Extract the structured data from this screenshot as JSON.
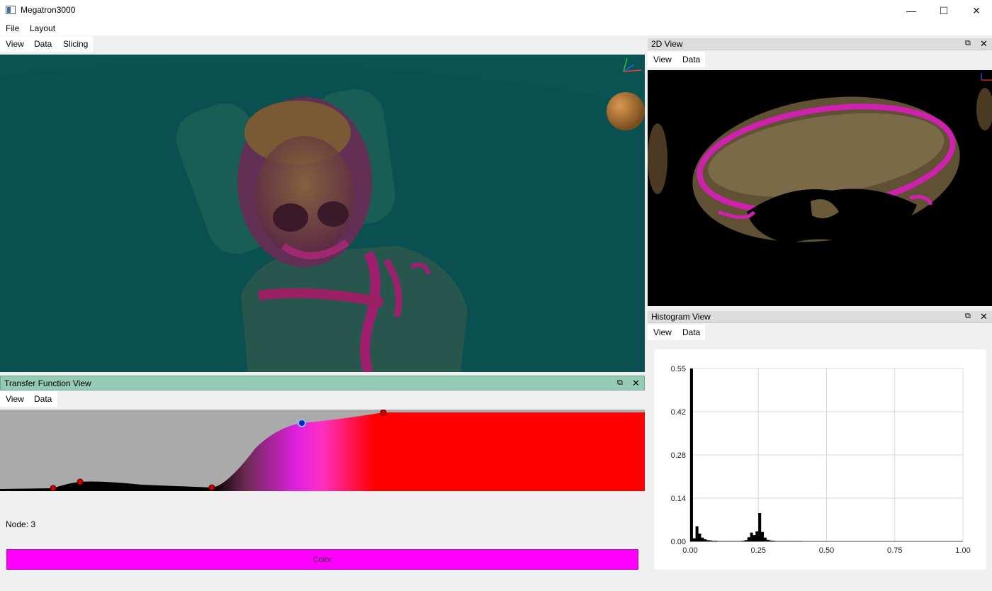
{
  "window": {
    "title": "Megatron3000",
    "minimize": "—",
    "maximize": "☐",
    "close": "✕"
  },
  "menubar": {
    "items": [
      "File",
      "Layout"
    ]
  },
  "view3d": {
    "toolbar": [
      "View",
      "Data",
      "Slicing"
    ],
    "background": "#0b5353"
  },
  "transfer_function": {
    "title": "Transfer Function View",
    "toolbar": [
      "View",
      "Data"
    ],
    "node_label": "Node: 3",
    "color_button": "Color",
    "selected_color": "#ff00ff",
    "float_icon": "⧉",
    "close_icon": "✕"
  },
  "view2d": {
    "title": "2D View",
    "toolbar": [
      "View",
      "Data"
    ],
    "float_icon": "⧉",
    "close_icon": "✕"
  },
  "histogram": {
    "title": "Histogram View",
    "toolbar": [
      "View",
      "Data"
    ],
    "float_icon": "⧉",
    "close_icon": "✕"
  },
  "chart_data": {
    "type": "bar",
    "title": "",
    "xlabel": "",
    "ylabel": "",
    "xlim": [
      0,
      1
    ],
    "ylim": [
      0,
      0.55
    ],
    "x_ticks": [
      "0.00",
      "0.25",
      "0.50",
      "0.75",
      "1.00"
    ],
    "y_ticks": [
      "0.00",
      "0.14",
      "0.28",
      "0.42",
      "0.55"
    ],
    "grid": true,
    "bins": [
      {
        "x": 0.005,
        "y": 0.55
      },
      {
        "x": 0.015,
        "y": 0.01
      },
      {
        "x": 0.025,
        "y": 0.048
      },
      {
        "x": 0.035,
        "y": 0.025
      },
      {
        "x": 0.045,
        "y": 0.012
      },
      {
        "x": 0.055,
        "y": 0.007
      },
      {
        "x": 0.065,
        "y": 0.004
      },
      {
        "x": 0.075,
        "y": 0.003
      },
      {
        "x": 0.085,
        "y": 0.002
      },
      {
        "x": 0.095,
        "y": 0.002
      },
      {
        "x": 0.105,
        "y": 0.001
      },
      {
        "x": 0.115,
        "y": 0.001
      },
      {
        "x": 0.125,
        "y": 0.001
      },
      {
        "x": 0.135,
        "y": 0.001
      },
      {
        "x": 0.145,
        "y": 0.001
      },
      {
        "x": 0.155,
        "y": 0.001
      },
      {
        "x": 0.165,
        "y": 0.001
      },
      {
        "x": 0.175,
        "y": 0.001
      },
      {
        "x": 0.185,
        "y": 0.001
      },
      {
        "x": 0.195,
        "y": 0.002
      },
      {
        "x": 0.205,
        "y": 0.004
      },
      {
        "x": 0.215,
        "y": 0.013
      },
      {
        "x": 0.225,
        "y": 0.028
      },
      {
        "x": 0.235,
        "y": 0.02
      },
      {
        "x": 0.245,
        "y": 0.032
      },
      {
        "x": 0.255,
        "y": 0.09
      },
      {
        "x": 0.265,
        "y": 0.03
      },
      {
        "x": 0.275,
        "y": 0.012
      },
      {
        "x": 0.285,
        "y": 0.005
      },
      {
        "x": 0.295,
        "y": 0.003
      },
      {
        "x": 0.305,
        "y": 0.002
      },
      {
        "x": 0.315,
        "y": 0.001
      },
      {
        "x": 0.325,
        "y": 0.001
      },
      {
        "x": 0.335,
        "y": 0.001
      },
      {
        "x": 0.345,
        "y": 0.001
      },
      {
        "x": 0.355,
        "y": 0.001
      },
      {
        "x": 0.365,
        "y": 0.001
      },
      {
        "x": 0.375,
        "y": 0.001
      },
      {
        "x": 0.385,
        "y": 0.001
      },
      {
        "x": 0.395,
        "y": 0.001
      },
      {
        "x": 0.405,
        "y": 0.001
      }
    ]
  }
}
